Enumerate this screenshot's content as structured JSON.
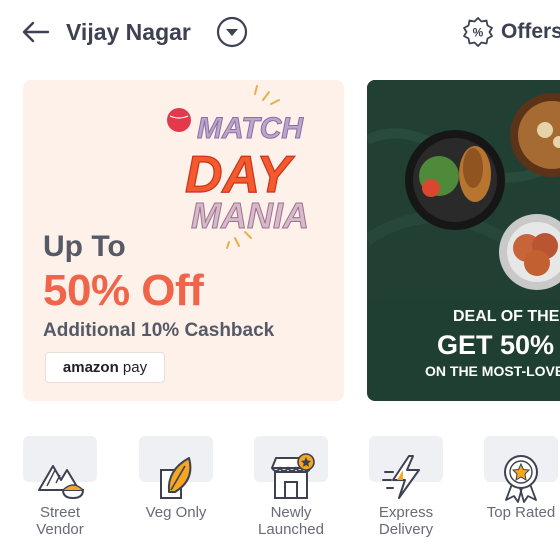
{
  "header": {
    "location": "Vijay Nagar",
    "offers_label": "Offers"
  },
  "banners": [
    {
      "logo_lines": [
        "MATCH",
        "DAY",
        "MANIA"
      ],
      "line1": "Up To",
      "line2": "50% Off",
      "line3": "Additional 10% Cashback",
      "pay_brand": "amazon",
      "pay_suffix": "pay"
    },
    {
      "line1": "DEAL OF THE",
      "line2": "GET 50%",
      "line3": "ON THE MOST-LOVE"
    }
  ],
  "categories": [
    {
      "label": "Street\nVendor",
      "icon": "street-vendor-icon"
    },
    {
      "label": "Veg Only",
      "icon": "veg-leaf-icon"
    },
    {
      "label": "Newly\nLaunched",
      "icon": "new-store-icon"
    },
    {
      "label": "Express\nDelivery",
      "icon": "lightning-icon"
    },
    {
      "label": "Top Rated",
      "icon": "star-badge-icon"
    }
  ],
  "colors": {
    "accent_orange": "#f0644a",
    "banner1_bg": "#fdf1ea",
    "banner2_bg": "#1f3f33",
    "text_dark": "#3d4152",
    "text_muted": "#686b78"
  }
}
